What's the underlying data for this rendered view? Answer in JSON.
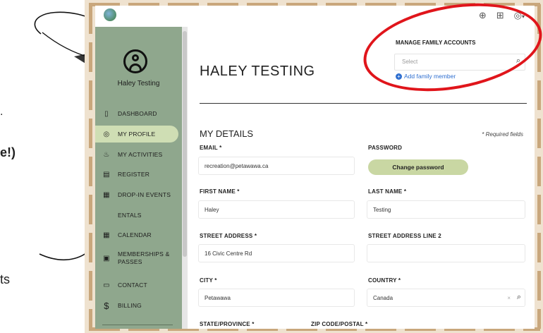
{
  "left_fragments": {
    "dot": ".",
    "bold_fragment": "e!)",
    "ts_fragment": "ts"
  },
  "topbar": {
    "icons": [
      "globe-icon",
      "cart-icon",
      "account-icon"
    ],
    "account_caret": "▾"
  },
  "sidebar": {
    "user_name": "Haley Testing",
    "items": [
      {
        "icon": "dashboard-icon",
        "glyph": "▯",
        "label": "DASHBOARD",
        "active": false
      },
      {
        "icon": "profile-icon",
        "glyph": "◎",
        "label": "MY PROFILE",
        "active": true
      },
      {
        "icon": "activities-icon",
        "glyph": "♨",
        "label": "MY ACTIVITIES",
        "active": false
      },
      {
        "icon": "register-icon",
        "glyph": "▤",
        "label": "REGISTER",
        "active": false
      },
      {
        "icon": "drop-in-icon",
        "glyph": "▦",
        "label": "DROP-IN EVENTS",
        "active": false
      },
      {
        "icon": "rentals-icon",
        "glyph": "",
        "label": "ENTALS",
        "active": false
      },
      {
        "icon": "calendar-icon",
        "glyph": "▦",
        "label": "CALENDAR",
        "active": false
      },
      {
        "icon": "membership-icon",
        "glyph": "▣",
        "label": "MEMBERSHIPS &",
        "label2": "PASSES",
        "active": false
      },
      {
        "icon": "contact-icon",
        "glyph": "▭",
        "label": "CONTACT",
        "active": false
      },
      {
        "icon": "billing-icon",
        "glyph": "$",
        "label": "BILLING",
        "active": false
      }
    ]
  },
  "header": {
    "title": "HALEY TESTING",
    "family": {
      "label": "MANAGE FAMILY ACCOUNTS",
      "placeholder": "Select",
      "add_link": "Add family member"
    }
  },
  "details": {
    "title": "MY DETAILS",
    "required_note": "* Required fields",
    "fields": {
      "email": {
        "label": "EMAIL *",
        "value": "recreation@petawawa.ca"
      },
      "password": {
        "label": "PASSWORD",
        "button": "Change password"
      },
      "first_name": {
        "label": "FIRST NAME *",
        "value": "Haley"
      },
      "last_name": {
        "label": "LAST NAME *",
        "value": "Testing"
      },
      "street": {
        "label": "STREET ADDRESS *",
        "value": "16 Civic Centre Rd"
      },
      "street2": {
        "label": "STREET ADDRESS LINE 2",
        "value": ""
      },
      "city": {
        "label": "CITY *",
        "value": "Petawawa"
      },
      "country": {
        "label": "COUNTRY *",
        "value": "Canada",
        "clear": "×"
      },
      "state": {
        "label": "STATE/PROVINCE *"
      },
      "zip": {
        "label": "ZIP CODE/POSTAL *"
      }
    }
  },
  "colors": {
    "sidebar": "#8fa78d",
    "active_item": "#cfdeb4",
    "button": "#c9d7a3",
    "link": "#2f6fd0",
    "annotation": "#e0151b"
  }
}
